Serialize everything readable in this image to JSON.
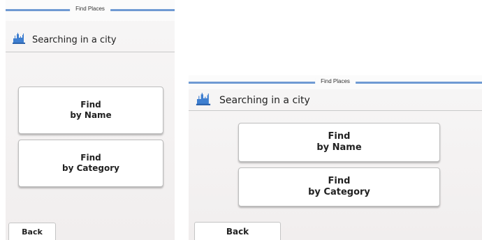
{
  "portrait": {
    "title": "Find Places",
    "header_icon": "city-icon",
    "header_text": "Searching in a city",
    "buttons": [
      {
        "label": "Find\nby Name"
      },
      {
        "label": "Find\nby Category"
      }
    ],
    "back_label": "Back"
  },
  "landscape": {
    "title": "Find Places",
    "header_icon": "city-icon",
    "header_text": "Searching in a city",
    "buttons": [
      {
        "label": "Find\nby Name"
      },
      {
        "label": "Find\nby Category"
      }
    ],
    "back_label": "Back"
  },
  "colors": {
    "title_line": "#6f9ad3",
    "icon_blue": "#3f7fd0"
  }
}
